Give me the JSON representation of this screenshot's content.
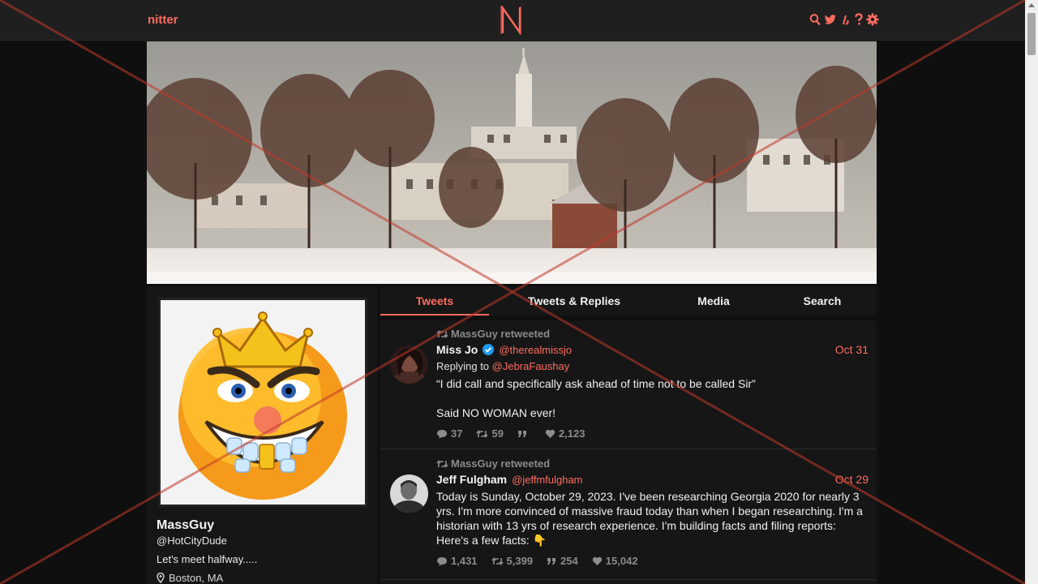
{
  "nav": {
    "brand": "nitter",
    "logo": "N",
    "icons": [
      "search-icon",
      "twitter-icon",
      "rss-icon",
      "help-icon",
      "settings-icon"
    ]
  },
  "colors": {
    "accent": "#ff6c60",
    "bg": "#0f0f0f",
    "panel": "#161616"
  },
  "profile": {
    "name": "MassGuy",
    "handle": "@HotCityDude",
    "bio": "Let's meet halfway.....",
    "location": "Boston, MA"
  },
  "tabs": [
    "Tweets",
    "Tweets & Replies",
    "Media",
    "Search"
  ],
  "tweets": [
    {
      "retweeted_by": "MassGuy retweeted",
      "name": "Miss Jo",
      "handle": "@therealmissjo",
      "date": "Oct 31",
      "replying_label": "Replying to",
      "replying_to": "@JebraFaushay",
      "text_1": "“I did call and specifically ask ahead of time not to be called Sir”",
      "text_2": "Said NO WOMAN ever!",
      "replies": "37",
      "retweets": "59",
      "quotes": "",
      "likes": "2,123"
    },
    {
      "retweeted_by": "MassGuy retweeted",
      "name": "Jeff Fulgham",
      "handle": "@jeffmfulgham",
      "date": "Oct 29",
      "text_1": "Today is Sunday, October 29, 2023. I've been researching Georgia 2020 for nearly 3 yrs. I'm more convinced of massive fraud today than when I began researching. I'm a historian with 13 yrs of research experience. I'm building facts and filing reports: Here's a few facts: 👇",
      "replies": "1,431",
      "retweets": "5,399",
      "quotes": "254",
      "likes": "15,042"
    }
  ]
}
